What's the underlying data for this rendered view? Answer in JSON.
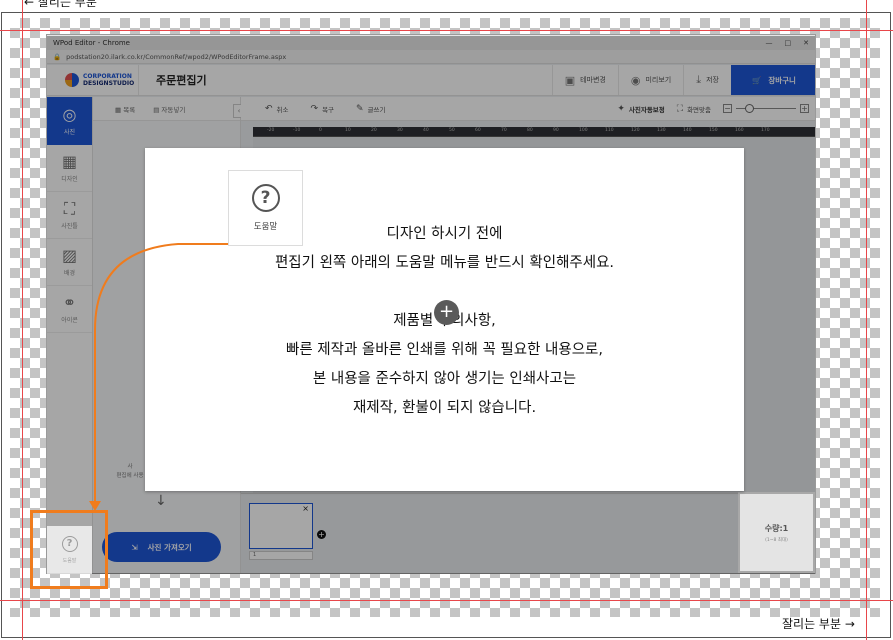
{
  "guides": {
    "top_label": "← 잘리는 부분",
    "bottom_label": "잘리는 부분 →"
  },
  "window": {
    "title": "WPod Editor - Chrome",
    "controls": [
      "—",
      "□",
      "✕"
    ],
    "url": "podstation20.ilark.co.kr/CommonRef/wpod2/WPodEditorFrame.aspx"
  },
  "header": {
    "logo_line1": "CORPORATION",
    "logo_line2": "DESIGNSTUDIO",
    "title": "주문편집기",
    "buttons": [
      {
        "label": "테마변경",
        "icon": "theme-icon"
      },
      {
        "label": "미리보기",
        "icon": "eye-icon"
      },
      {
        "label": "저장",
        "icon": "download-icon"
      }
    ],
    "cart_label": "장바구니",
    "colors": {
      "primary": "#1e56d6",
      "highlight": "#f07c1d",
      "guide": "#e8464a"
    }
  },
  "left_nav": [
    {
      "label": "사진",
      "icon": "camera-icon",
      "active": true
    },
    {
      "label": "디자인",
      "icon": "layout-icon",
      "active": false
    },
    {
      "label": "사진틀",
      "icon": "frame-icon",
      "active": false
    },
    {
      "label": "배경",
      "icon": "background-icon",
      "active": false
    },
    {
      "label": "아이콘",
      "icon": "shapes-icon",
      "active": false
    }
  ],
  "panel": {
    "list_label": "목록",
    "autofill_label": "자동넣기",
    "collapse": "‹",
    "side_text_line1": "사",
    "side_text_line2": "편집에 사용",
    "upload_button": "사진 가져오기",
    "help_label": "도움말"
  },
  "toolbar": {
    "undo": "취소",
    "redo": "복구",
    "text": "글쓰기",
    "auto_correct": "사진자동보정",
    "fit_screen": "화면맞춤",
    "zoom_out": "−",
    "zoom_in": "+",
    "zoom_level": 0.15
  },
  "ruler": [
    "-20",
    "-10",
    "0",
    "10",
    "20",
    "30",
    "40",
    "50",
    "60",
    "70",
    "80",
    "90",
    "100",
    "110",
    "120",
    "130",
    "140",
    "150",
    "160",
    "170"
  ],
  "pages": {
    "close": "×",
    "add": "+",
    "page_number": "1"
  },
  "quantity": {
    "label": "수량:1",
    "sub": "(1~8 최대)"
  },
  "popup": {
    "lines": [
      "디자인 하시기 전에",
      "편집기 왼쪽 아래의 도움말 메뉴를 반드시 확인해주세요.",
      "",
      "제품별 주의사항,",
      "빠른 제작과 올바른 인쇄를 위해 꼭 필요한 내용으로,",
      "본 내용을 준수하지 않아 생기는 인쇄사고는",
      "재제작, 환불이 되지 않습니다."
    ],
    "help_label": "도움말",
    "help_symbol": "?",
    "center_symbol": "+"
  }
}
